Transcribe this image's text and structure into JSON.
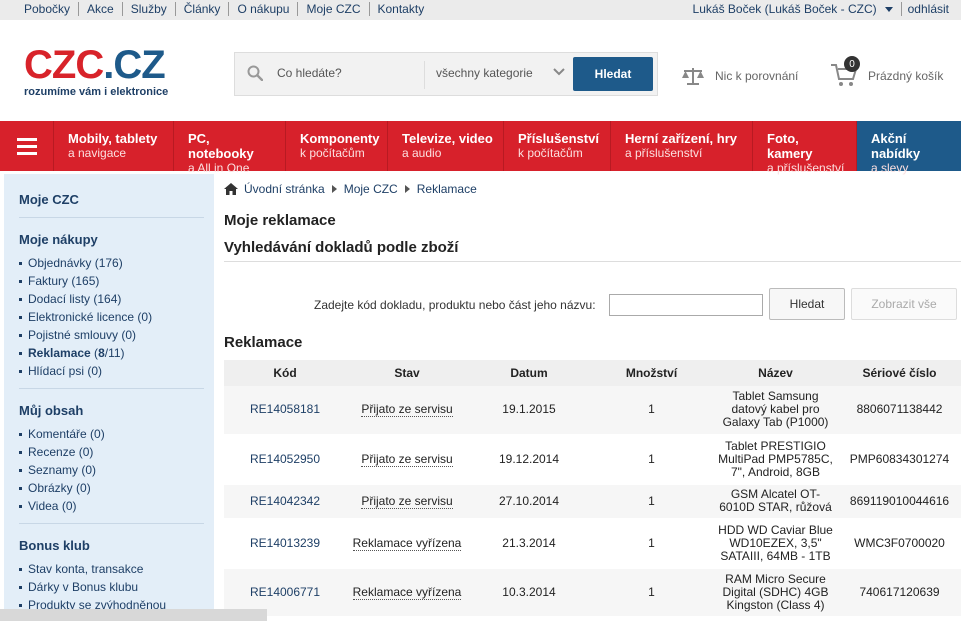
{
  "topbar": {
    "links": [
      "Pobočky",
      "Akce",
      "Služby",
      "Články",
      "O nákupu",
      "Moje CZC",
      "Kontakty"
    ],
    "user": "Lukáš Boček (Lukáš Boček - CZC)",
    "logout": "odhlásit"
  },
  "header": {
    "logo_part1": "CZC",
    "logo_part2": ".CZ",
    "tagline": "rozumíme vám i elektronice",
    "search_placeholder": "Co hledáte?",
    "category": "všechny kategorie",
    "search_button": "Hledat",
    "compare": "Nic k porovnání",
    "cart_count": "0",
    "cart_label": "Prázdný košík"
  },
  "nav": [
    {
      "title": "Mobily, tablety",
      "sub": "a navigace"
    },
    {
      "title": "PC, notebooky",
      "sub": "a All in One"
    },
    {
      "title": "Komponenty",
      "sub": "k počítačům"
    },
    {
      "title": "Televize, video",
      "sub": "a audio"
    },
    {
      "title": "Příslušenství",
      "sub": "k počítačům"
    },
    {
      "title": "Herní zařízení, hry",
      "sub": "a příslušenství"
    },
    {
      "title": "Foto, kamery",
      "sub": "a příslušenství"
    },
    {
      "title": "Akční nabídky",
      "sub": "a slevy"
    }
  ],
  "sidebar": {
    "heading": "Moje CZC",
    "groups": [
      {
        "title": "Moje nákupy",
        "items": [
          {
            "label": "Objednávky",
            "count": " (176)"
          },
          {
            "label": "Faktury",
            "count": " (165)"
          },
          {
            "label": "Dodací listy",
            "count": " (164)"
          },
          {
            "label": "Elektronické licence",
            "count": " (0)"
          },
          {
            "label": "Pojistné smlouvy",
            "count": " (0)"
          },
          {
            "label": "Reklamace",
            "count_open": " (",
            "count_bold": "8",
            "count_rest": "/11)"
          },
          {
            "label": "Hlídací psi",
            "count": " (0)"
          }
        ]
      },
      {
        "title": "Můj obsah",
        "items": [
          {
            "label": "Komentáře",
            "count": " (0)"
          },
          {
            "label": "Recenze",
            "count": " (0)"
          },
          {
            "label": "Seznamy",
            "count": " (0)"
          },
          {
            "label": "Obrázky",
            "count": " (0)"
          },
          {
            "label": "Videa",
            "count": " (0)"
          }
        ]
      },
      {
        "title": "Bonus klub",
        "items": [
          {
            "label": "Stav konta, transakce",
            "count": ""
          },
          {
            "label": "Dárky v Bonus klubu",
            "count": ""
          },
          {
            "label": "Produkty se zvýhodněnou",
            "count": ""
          }
        ]
      }
    ]
  },
  "breadcrumb": [
    "Úvodní stránka",
    "Moje CZC",
    "Reklamace"
  ],
  "main": {
    "title": "Moje reklamace",
    "search_title": "Vyhledávání dokladů podle zboží",
    "search_label": "Zadejte kód dokladu, produktu nebo část jeho názvu:",
    "search_button": "Hledat",
    "show_all": "Zobrazit vše",
    "table_title": "Reklamace",
    "columns": [
      "Kód",
      "Stav",
      "Datum",
      "Množství",
      "Název",
      "Sériové číslo"
    ],
    "rows": [
      {
        "code": "RE14058181",
        "status": "Přijato ze servisu",
        "date": "19.1.2015",
        "qty": "1",
        "name1": "Tablet Samsung",
        "name2": "datový kabel pro",
        "name3": "Galaxy Tab (P1000)",
        "serial": "8806071138442"
      },
      {
        "code": "RE14052950",
        "status": "Přijato ze servisu",
        "date": "19.12.2014",
        "qty": "1",
        "name1": "Tablet PRESTIGIO",
        "name2": "MultiPad PMP5785C,",
        "name3": "7\", Android, 8GB",
        "serial": "PMP60834301274"
      },
      {
        "code": "RE14042342",
        "status": "Přijato ze servisu",
        "date": "27.10.2014",
        "qty": "1",
        "name1": "GSM Alcatel OT-",
        "name2": "6010D STAR, růžová",
        "name3": "",
        "serial": "869119010044616"
      },
      {
        "code": "RE14013239",
        "status": "Reklamace vyřízena",
        "date": "21.3.2014",
        "qty": "1",
        "name1": "HDD WD Caviar Blue",
        "name2": "WD10EZEX, 3,5\"",
        "name3": "SATAIII, 64MB - 1TB",
        "serial": "WMC3F0700020"
      },
      {
        "code": "RE14006771",
        "status": "Reklamace vyřízena",
        "date": "10.3.2014",
        "qty": "1",
        "name1": "RAM Micro Secure",
        "name2": "Digital (SDHC) 4GB",
        "name3": "Kingston (Class 4)",
        "serial": "740617120639"
      }
    ]
  }
}
